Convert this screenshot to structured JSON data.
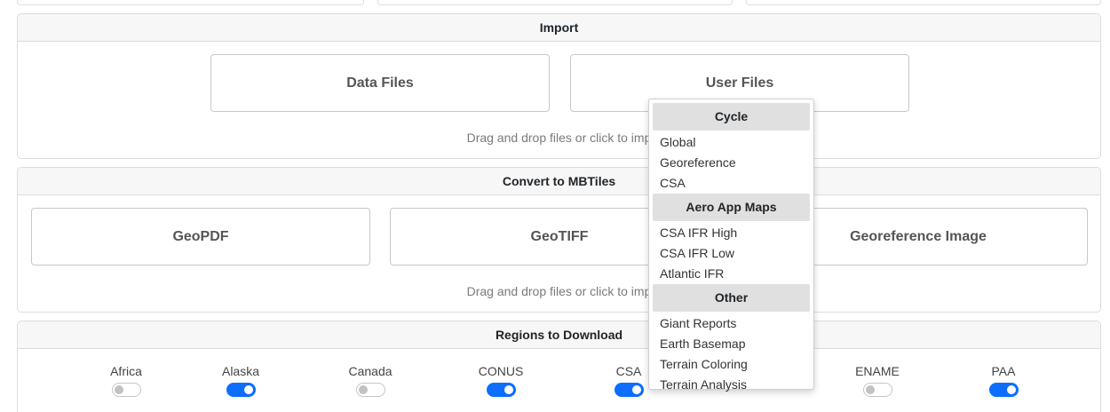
{
  "import": {
    "title": "Import",
    "data_files_label": "Data Files",
    "user_files_label": "User Files",
    "hint": "Drag and drop files or click to imp"
  },
  "convert": {
    "title": "Convert to MBTiles",
    "geopdf_label": "GeoPDF",
    "geotiff_label": "GeoTIFF",
    "georef_label": "Georeference Image",
    "hint": "Drag and drop files or click to imp"
  },
  "regions": {
    "title": "Regions to Download",
    "items": [
      {
        "label": "Africa",
        "enabled": false
      },
      {
        "label": "Alaska",
        "enabled": true
      },
      {
        "label": "Canada",
        "enabled": false
      },
      {
        "label": "CONUS",
        "enabled": true
      },
      {
        "label": "CSA",
        "enabled": true
      },
      {
        "label": "",
        "enabled": false
      },
      {
        "label": "ENAME",
        "enabled": false
      },
      {
        "label": "PAA",
        "enabled": true
      }
    ]
  },
  "dropdown": {
    "groups": [
      {
        "header": "Cycle",
        "items": [
          "Global",
          "Georeference",
          "CSA"
        ]
      },
      {
        "header": "Aero App Maps",
        "items": [
          "CSA IFR High",
          "CSA IFR Low",
          "Atlantic IFR"
        ]
      },
      {
        "header": "Other",
        "items": [
          "Giant Reports",
          "Earth Basemap",
          "Terrain Coloring",
          "Terrain Analysis"
        ]
      }
    ]
  },
  "colors": {
    "accent": "#0d6efd",
    "header_bg": "#f7f7f7",
    "dropdown_header_bg": "#e0e0e0"
  }
}
